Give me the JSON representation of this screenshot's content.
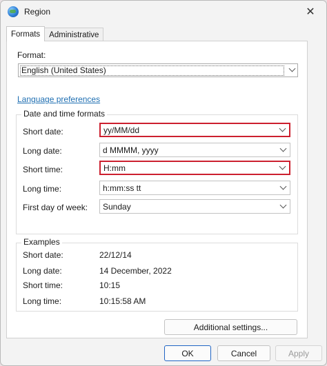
{
  "window": {
    "title": "Region",
    "close_glyph": "✕"
  },
  "tabs": [
    {
      "label": "Formats",
      "active": true
    },
    {
      "label": "Administrative",
      "active": false
    }
  ],
  "format": {
    "label": "Format:",
    "value": "English (United States)"
  },
  "language_link": "Language preferences",
  "date_time_formats": {
    "title": "Date and time formats",
    "rows": [
      {
        "label": "Short date:",
        "value": "yy/MM/dd",
        "highlighted": true
      },
      {
        "label": "Long date:",
        "value": "d MMMM, yyyy",
        "highlighted": false
      },
      {
        "label": "Short time:",
        "value": "H:mm",
        "highlighted": true
      },
      {
        "label": "Long time:",
        "value": "h:mm:ss tt",
        "highlighted": false
      },
      {
        "label": "First day of week:",
        "value": "Sunday",
        "highlighted": false
      }
    ]
  },
  "examples": {
    "title": "Examples",
    "rows": [
      {
        "label": "Short date:",
        "value": "22/12/14"
      },
      {
        "label": "Long date:",
        "value": "14 December, 2022"
      },
      {
        "label": "Short time:",
        "value": "10:15"
      },
      {
        "label": "Long time:",
        "value": "10:15:58 AM"
      }
    ]
  },
  "buttons": {
    "additional": "Additional settings...",
    "ok": "OK",
    "cancel": "Cancel",
    "apply": "Apply"
  },
  "colors": {
    "highlight": "#cc1f2e",
    "link": "#1f6fb2",
    "primary_border": "#1f64c4"
  }
}
